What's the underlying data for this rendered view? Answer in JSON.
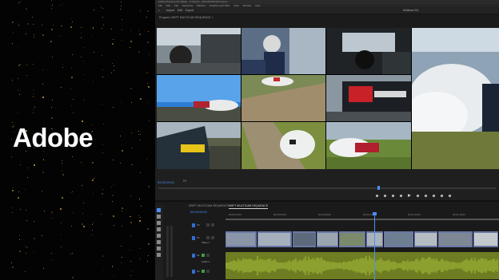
{
  "brand": {
    "logo_text": "Adobe"
  },
  "titlebar": {
    "text": "Adobe Premiere Pro (Beta) - C:\\Users\\…\\MULTICAM EDIT.prproj"
  },
  "menu": {
    "items": [
      "File",
      "Edit",
      "Clip",
      "Sequence",
      "Markers",
      "Graphics and Titles",
      "View",
      "Window",
      "Help"
    ]
  },
  "workspaces": {
    "home_icon": "home-icon",
    "tabs": [
      "Import",
      "Edit",
      "Export"
    ],
    "right_label": "Multicam Ed"
  },
  "program_monitor": {
    "title": "Program: MSFT MULTICAM SEQUENCE ≡",
    "timecode": "00;00;05;01",
    "fit": "Fit"
  },
  "sequence": {
    "tabs": [
      "DRIFT MULTICAM SEQUENCE",
      "MSFT MULTICAM SEQUENCE"
    ],
    "timecode": "00;00;05;01",
    "ruler_labels": [
      "00;00;16;00",
      "00;00;32;00",
      "00;00;48;00",
      "00;01;04;02",
      "00;01;20;02",
      "00;01;36;02"
    ]
  },
  "tracks": {
    "v2": "V2",
    "v1": "V1",
    "a1": "A1",
    "a2": "A2",
    "v1_name": "Video 1",
    "a1_name": "Audio 1"
  },
  "colors": {
    "accent": "#4c8ef7",
    "audio": "#6e7d22",
    "video_clip": "#6a78a6",
    "brand_sparkle": "#d8a94a"
  },
  "icons": {
    "transport": [
      "mark-in-icon",
      "mark-out-icon",
      "go-to-in-icon",
      "step-back-icon",
      "play-icon",
      "step-forward-icon",
      "go-to-out-icon",
      "insert-icon",
      "overwrite-icon",
      "export-frame-icon"
    ]
  }
}
